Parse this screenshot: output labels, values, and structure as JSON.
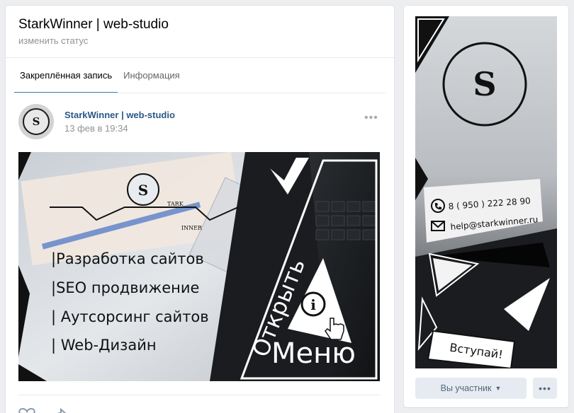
{
  "profile": {
    "name": "StarkWinner | web-studio",
    "status_link": "изменить статус"
  },
  "tabs": [
    {
      "label": "Закреплённая запись",
      "active": true
    },
    {
      "label": "Информация",
      "active": false
    }
  ],
  "post": {
    "author": "StarkWinner | web-studio",
    "date": "13 фев в 19:34",
    "more_icon": "ellipsis-icon",
    "image": {
      "logo_letter": "S",
      "logo_sub_top": "TARK",
      "logo_sub_bottom": "INNER",
      "services": [
        "|Разработка сайтов",
        "|SEO продвижение",
        "| Аутсорсинг сайтов",
        "| Web-Дизайн"
      ],
      "cta_top": "Открыть",
      "cta_bottom": "Меню",
      "info_glyph": "i"
    }
  },
  "cover": {
    "logo_letter": "S",
    "phone": "8 ( 950 ) 222 28 90",
    "email": "help@starkwinner.ru",
    "join": "Вступай!"
  },
  "actions": {
    "member_label": "Вы участник",
    "member_chevron": "chevron-down-icon",
    "more_label": "•••"
  },
  "colors": {
    "accent": "#5181b8",
    "link": "#2a5885",
    "button_bg": "#e5ebf1",
    "button_text": "#55677d"
  }
}
